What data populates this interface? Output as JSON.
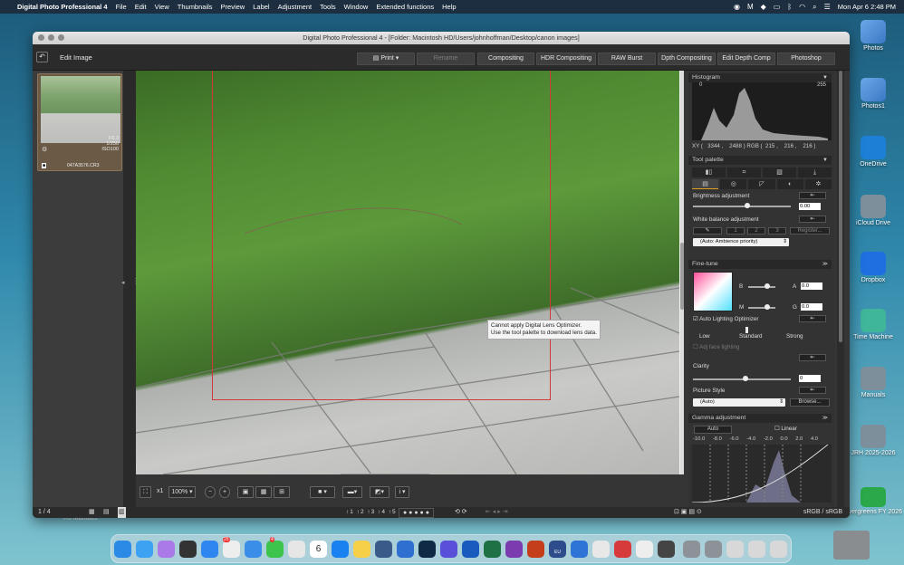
{
  "menubar": {
    "app": "Digital Photo Professional 4",
    "items": [
      "File",
      "Edit",
      "View",
      "Thumbnails",
      "Preview",
      "Label",
      "Adjustment",
      "Tools",
      "Window",
      "Extended functions",
      "Help"
    ],
    "clock": "Mon Apr 6  2:48 PM"
  },
  "window": {
    "title": "Digital Photo Professional 4 - [Folder: Macintosh HD/Users/johnhoffman/Desktop/canon images]"
  },
  "toolbar": {
    "edit_title": "Edit Image",
    "print": "Print",
    "rename": "Rename",
    "compositing": "Compositing",
    "hdr": "HDR Compositing",
    "raw_burst": "RAW Burst",
    "dpth": "Dpth Compositing",
    "edit_depth": "Edit Depth Comp",
    "photoshop": "Photoshop"
  },
  "thumbnail": {
    "fstop": "F6.3",
    "shutter": "1/250",
    "iso": "ISO100",
    "filename": "047A3576.CR3"
  },
  "viewer": {
    "tooltip_line1": "Cannot apply Digital Lens Optimizer.",
    "tooltip_line2": "Use the tool palette to download lens data.",
    "zoom": "100%",
    "zoom_prefix": "x1",
    "labels": [
      "1",
      "2",
      "3",
      "4",
      "5"
    ]
  },
  "histogram": {
    "title": "Histogram",
    "min": "0",
    "max": "255",
    "xy_readout": "XY (   3344 ,    2488 ) RGB (  215 ,    216 ,    216 )"
  },
  "tool_palette": {
    "title": "Tool palette",
    "brightness": "Brightness adjustment",
    "brightness_value": "0.00",
    "white_balance": "White balance adjustment",
    "wb_presets": [
      "1",
      "2",
      "3"
    ],
    "register": "Register...",
    "wb_mode": "(Auto: Ambience priority)"
  },
  "fine_tune": {
    "title": "Fine-tune",
    "b_label": "B",
    "m_label": "M",
    "a_label": "A",
    "g_label": "G",
    "a_value": "0.0",
    "g_value": "0.0",
    "alo": "Auto Lighting Optimizer",
    "alo_levels": [
      "Low",
      "Standard",
      "Strong"
    ],
    "adj_face": "Adj face lighting",
    "clarity": "Clarity",
    "clarity_value": "0",
    "picture_style": "Picture Style",
    "ps_value": "(Auto)",
    "browse": "Browse..."
  },
  "gamma": {
    "title": "Gamma adjustment",
    "auto": "Auto",
    "linear": "Linear",
    "ticks": [
      "-10.0",
      "-8.0",
      "-6.0",
      "-4.0",
      "-2.0",
      "0.0",
      "2.0",
      "4.0"
    ]
  },
  "status": {
    "page": "1 / 4",
    "color_space": "sRGB / sRGB"
  },
  "desktop": {
    "icons": [
      "Photos",
      "Photos1",
      "OneDrive",
      "iCloud Drive",
      "Dropbox",
      "Time Machine",
      "Manuals",
      "JRH 2025-2026",
      "Evergreens FY 2026"
    ],
    "behind_label": "R6 Manuals"
  },
  "dock": {
    "calendar_day": "6",
    "mail_badge": "25",
    "msg_badge": "4",
    "eu": "EU"
  },
  "colors": {
    "accent": "#e0a020",
    "red_frame": "#d23a3a"
  }
}
